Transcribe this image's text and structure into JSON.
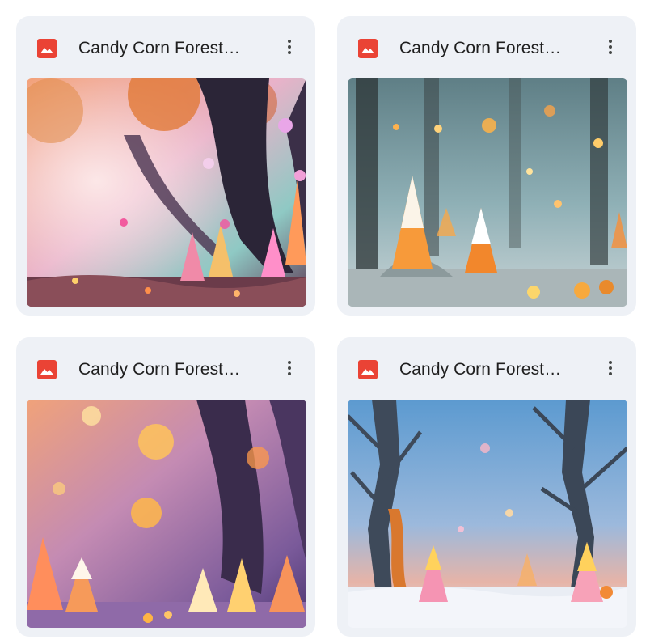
{
  "files": [
    {
      "title": "Candy Corn Forest…",
      "icon": "image-file-icon",
      "menu_icon": "more-vert-icon"
    },
    {
      "title": "Candy Corn Forest…",
      "icon": "image-file-icon",
      "menu_icon": "more-vert-icon"
    },
    {
      "title": "Candy Corn Forest…",
      "icon": "image-file-icon",
      "menu_icon": "more-vert-icon"
    },
    {
      "title": "Candy Corn Forest…",
      "icon": "image-file-icon",
      "menu_icon": "more-vert-icon"
    }
  ],
  "colors": {
    "card_bg": "#eef1f6",
    "icon_red": "#ea4335",
    "title_text": "#1f1f1f",
    "menu_dots": "#444746"
  }
}
